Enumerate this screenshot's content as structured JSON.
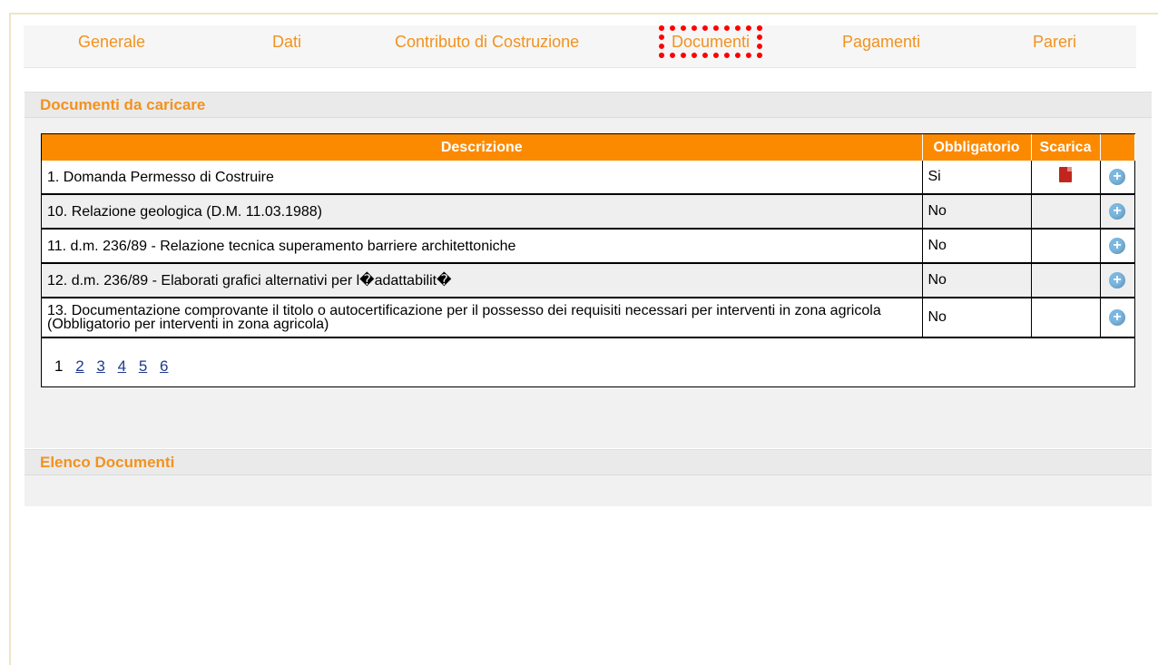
{
  "tabs": [
    "Generale",
    "Dati",
    "Contributo di Costruzione",
    "Documenti",
    "Pagamenti",
    "Pareri"
  ],
  "active_tab": "Documenti",
  "section_upload": {
    "title": "Documenti da caricare"
  },
  "table": {
    "headers": [
      "Descrizione",
      "Obbligatorio",
      "Scarica",
      ""
    ],
    "rows": [
      {
        "desc": "1. Domanda Permesso di Costruire",
        "obbligatorio": "Si",
        "scarica": "pdf-icon"
      },
      {
        "desc": "10. Relazione geologica (D.M. 11.03.1988)",
        "obbligatorio": "No"
      },
      {
        "desc": "11. d.m. 236/89 - Relazione tecnica superamento barriere architettoniche",
        "obbligatorio": "No"
      },
      {
        "desc": "12. d.m. 236/89 - Elaborati grafici alternativi per l�adattabilit�",
        "obbligatorio": "No"
      },
      {
        "desc": "13. Documentazione comprovante il titolo o autocertificazione per il possesso dei requisiti necessari per interventi in zona agricola (Obbligatorio per interventi in zona agricola)",
        "obbligatorio": "No"
      }
    ],
    "add_icon": "plus-circle-icon"
  },
  "pager": {
    "current": "1",
    "pages": [
      "2",
      "3",
      "4",
      "5",
      "6"
    ]
  },
  "section_list": {
    "title": "Elenco Documenti"
  },
  "colors": {
    "accent": "#fc8a00",
    "tab_text": "#f2921e",
    "highlight": "#ff0000"
  }
}
